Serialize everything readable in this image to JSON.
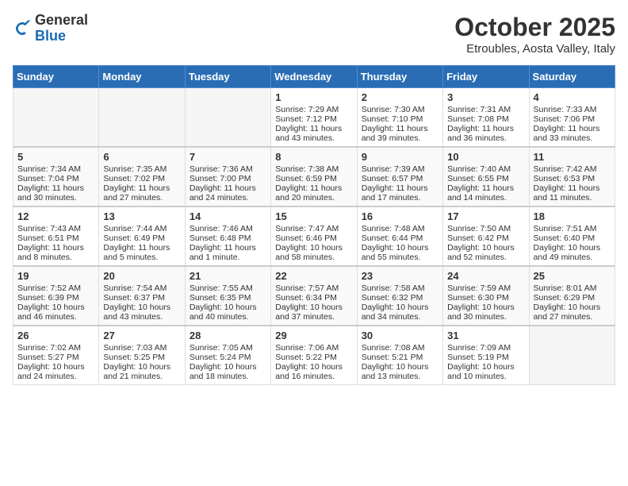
{
  "header": {
    "logo_general": "General",
    "logo_blue": "Blue",
    "title": "October 2025",
    "subtitle": "Etroubles, Aosta Valley, Italy"
  },
  "days_of_week": [
    "Sunday",
    "Monday",
    "Tuesday",
    "Wednesday",
    "Thursday",
    "Friday",
    "Saturday"
  ],
  "weeks": [
    [
      {
        "num": "",
        "empty": true
      },
      {
        "num": "",
        "empty": true
      },
      {
        "num": "",
        "empty": true
      },
      {
        "num": "1",
        "sunrise": "Sunrise: 7:29 AM",
        "sunset": "Sunset: 7:12 PM",
        "daylight": "Daylight: 11 hours and 43 minutes."
      },
      {
        "num": "2",
        "sunrise": "Sunrise: 7:30 AM",
        "sunset": "Sunset: 7:10 PM",
        "daylight": "Daylight: 11 hours and 39 minutes."
      },
      {
        "num": "3",
        "sunrise": "Sunrise: 7:31 AM",
        "sunset": "Sunset: 7:08 PM",
        "daylight": "Daylight: 11 hours and 36 minutes."
      },
      {
        "num": "4",
        "sunrise": "Sunrise: 7:33 AM",
        "sunset": "Sunset: 7:06 PM",
        "daylight": "Daylight: 11 hours and 33 minutes."
      }
    ],
    [
      {
        "num": "5",
        "sunrise": "Sunrise: 7:34 AM",
        "sunset": "Sunset: 7:04 PM",
        "daylight": "Daylight: 11 hours and 30 minutes."
      },
      {
        "num": "6",
        "sunrise": "Sunrise: 7:35 AM",
        "sunset": "Sunset: 7:02 PM",
        "daylight": "Daylight: 11 hours and 27 minutes."
      },
      {
        "num": "7",
        "sunrise": "Sunrise: 7:36 AM",
        "sunset": "Sunset: 7:00 PM",
        "daylight": "Daylight: 11 hours and 24 minutes."
      },
      {
        "num": "8",
        "sunrise": "Sunrise: 7:38 AM",
        "sunset": "Sunset: 6:59 PM",
        "daylight": "Daylight: 11 hours and 20 minutes."
      },
      {
        "num": "9",
        "sunrise": "Sunrise: 7:39 AM",
        "sunset": "Sunset: 6:57 PM",
        "daylight": "Daylight: 11 hours and 17 minutes."
      },
      {
        "num": "10",
        "sunrise": "Sunrise: 7:40 AM",
        "sunset": "Sunset: 6:55 PM",
        "daylight": "Daylight: 11 hours and 14 minutes."
      },
      {
        "num": "11",
        "sunrise": "Sunrise: 7:42 AM",
        "sunset": "Sunset: 6:53 PM",
        "daylight": "Daylight: 11 hours and 11 minutes."
      }
    ],
    [
      {
        "num": "12",
        "sunrise": "Sunrise: 7:43 AM",
        "sunset": "Sunset: 6:51 PM",
        "daylight": "Daylight: 11 hours and 8 minutes."
      },
      {
        "num": "13",
        "sunrise": "Sunrise: 7:44 AM",
        "sunset": "Sunset: 6:49 PM",
        "daylight": "Daylight: 11 hours and 5 minutes."
      },
      {
        "num": "14",
        "sunrise": "Sunrise: 7:46 AM",
        "sunset": "Sunset: 6:48 PM",
        "daylight": "Daylight: 11 hours and 1 minute."
      },
      {
        "num": "15",
        "sunrise": "Sunrise: 7:47 AM",
        "sunset": "Sunset: 6:46 PM",
        "daylight": "Daylight: 10 hours and 58 minutes."
      },
      {
        "num": "16",
        "sunrise": "Sunrise: 7:48 AM",
        "sunset": "Sunset: 6:44 PM",
        "daylight": "Daylight: 10 hours and 55 minutes."
      },
      {
        "num": "17",
        "sunrise": "Sunrise: 7:50 AM",
        "sunset": "Sunset: 6:42 PM",
        "daylight": "Daylight: 10 hours and 52 minutes."
      },
      {
        "num": "18",
        "sunrise": "Sunrise: 7:51 AM",
        "sunset": "Sunset: 6:40 PM",
        "daylight": "Daylight: 10 hours and 49 minutes."
      }
    ],
    [
      {
        "num": "19",
        "sunrise": "Sunrise: 7:52 AM",
        "sunset": "Sunset: 6:39 PM",
        "daylight": "Daylight: 10 hours and 46 minutes."
      },
      {
        "num": "20",
        "sunrise": "Sunrise: 7:54 AM",
        "sunset": "Sunset: 6:37 PM",
        "daylight": "Daylight: 10 hours and 43 minutes."
      },
      {
        "num": "21",
        "sunrise": "Sunrise: 7:55 AM",
        "sunset": "Sunset: 6:35 PM",
        "daylight": "Daylight: 10 hours and 40 minutes."
      },
      {
        "num": "22",
        "sunrise": "Sunrise: 7:57 AM",
        "sunset": "Sunset: 6:34 PM",
        "daylight": "Daylight: 10 hours and 37 minutes."
      },
      {
        "num": "23",
        "sunrise": "Sunrise: 7:58 AM",
        "sunset": "Sunset: 6:32 PM",
        "daylight": "Daylight: 10 hours and 34 minutes."
      },
      {
        "num": "24",
        "sunrise": "Sunrise: 7:59 AM",
        "sunset": "Sunset: 6:30 PM",
        "daylight": "Daylight: 10 hours and 30 minutes."
      },
      {
        "num": "25",
        "sunrise": "Sunrise: 8:01 AM",
        "sunset": "Sunset: 6:29 PM",
        "daylight": "Daylight: 10 hours and 27 minutes."
      }
    ],
    [
      {
        "num": "26",
        "sunrise": "Sunrise: 7:02 AM",
        "sunset": "Sunset: 5:27 PM",
        "daylight": "Daylight: 10 hours and 24 minutes."
      },
      {
        "num": "27",
        "sunrise": "Sunrise: 7:03 AM",
        "sunset": "Sunset: 5:25 PM",
        "daylight": "Daylight: 10 hours and 21 minutes."
      },
      {
        "num": "28",
        "sunrise": "Sunrise: 7:05 AM",
        "sunset": "Sunset: 5:24 PM",
        "daylight": "Daylight: 10 hours and 18 minutes."
      },
      {
        "num": "29",
        "sunrise": "Sunrise: 7:06 AM",
        "sunset": "Sunset: 5:22 PM",
        "daylight": "Daylight: 10 hours and 16 minutes."
      },
      {
        "num": "30",
        "sunrise": "Sunrise: 7:08 AM",
        "sunset": "Sunset: 5:21 PM",
        "daylight": "Daylight: 10 hours and 13 minutes."
      },
      {
        "num": "31",
        "sunrise": "Sunrise: 7:09 AM",
        "sunset": "Sunset: 5:19 PM",
        "daylight": "Daylight: 10 hours and 10 minutes."
      },
      {
        "num": "",
        "empty": true
      }
    ]
  ]
}
